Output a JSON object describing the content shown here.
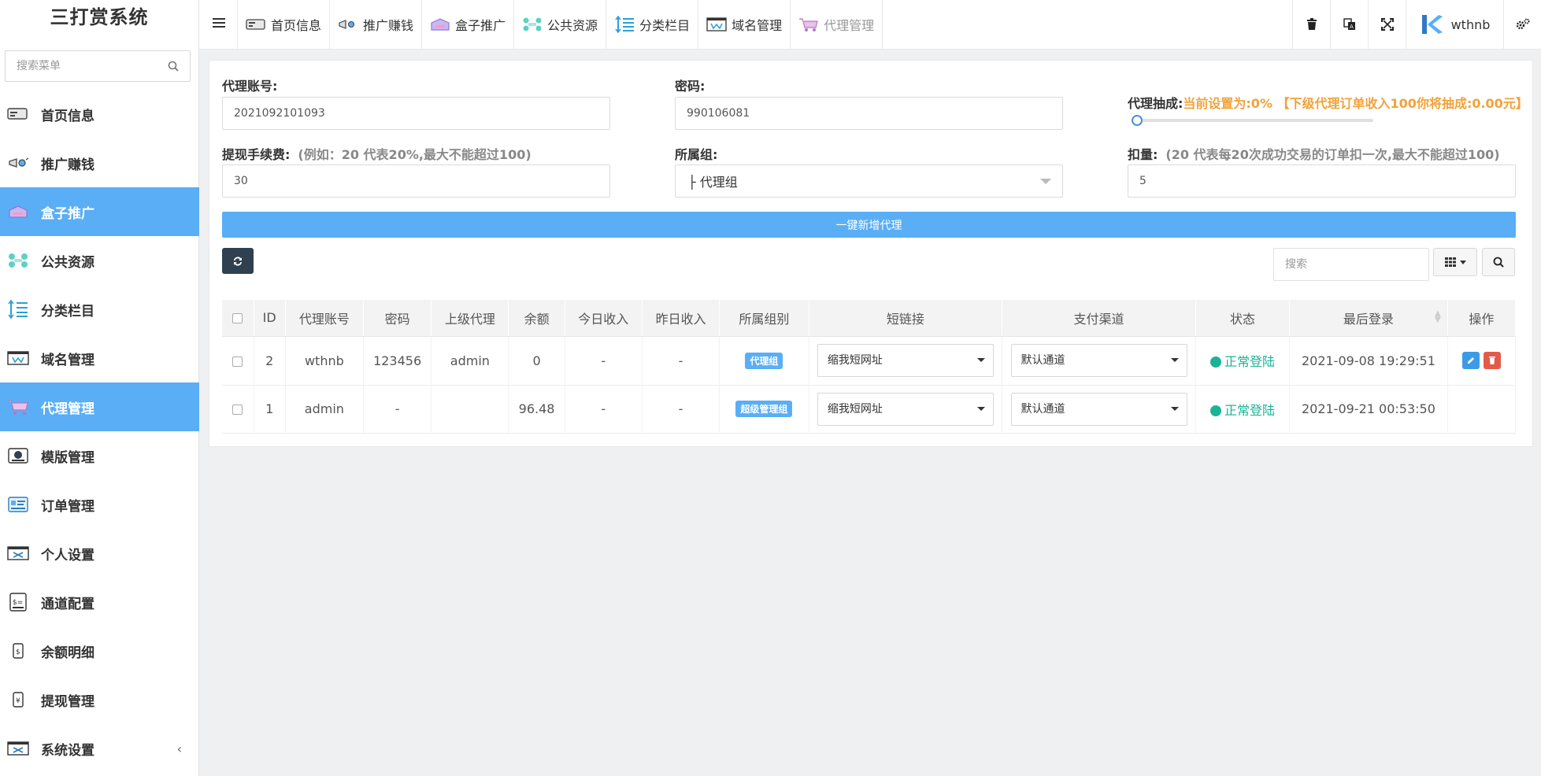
{
  "app": {
    "title": "三打赏系统"
  },
  "sidebar": {
    "search_placeholder": "搜索菜单",
    "items": [
      {
        "label": "首页信息",
        "icon": "home-card-icon",
        "active": false
      },
      {
        "label": "推广赚钱",
        "icon": "megaphone-icon",
        "active": false
      },
      {
        "label": "盒子推广",
        "icon": "box-icon",
        "active": true
      },
      {
        "label": "公共资源",
        "icon": "share-icon",
        "active": false
      },
      {
        "label": "分类栏目",
        "icon": "list-icon",
        "active": false
      },
      {
        "label": "域名管理",
        "icon": "domain-icon",
        "active": false
      },
      {
        "label": "代理管理",
        "icon": "cart-icon",
        "active": true
      },
      {
        "label": "模版管理",
        "icon": "template-icon",
        "active": false
      },
      {
        "label": "订单管理",
        "icon": "order-icon",
        "active": false
      },
      {
        "label": "个人设置",
        "icon": "settings-card-icon",
        "active": false
      },
      {
        "label": "通道配置",
        "icon": "channel-icon",
        "active": false
      },
      {
        "label": "余额明细",
        "icon": "balance-icon",
        "active": false
      },
      {
        "label": "提现管理",
        "icon": "withdraw-icon",
        "active": false
      },
      {
        "label": "系统设置",
        "icon": "system-icon",
        "active": false,
        "arrow": "‹"
      }
    ]
  },
  "topnav": {
    "tabs": [
      {
        "label": "首页信息",
        "icon": "home-card-icon"
      },
      {
        "label": "推广赚钱",
        "icon": "megaphone-icon"
      },
      {
        "label": "盒子推广",
        "icon": "box-icon"
      },
      {
        "label": "公共资源",
        "icon": "share-icon"
      },
      {
        "label": "分类栏目",
        "icon": "list-icon"
      },
      {
        "label": "域名管理",
        "icon": "domain-icon"
      },
      {
        "label": "代理管理",
        "icon": "cart-icon"
      }
    ],
    "user": "wthnb"
  },
  "form": {
    "account_label": "代理账号:",
    "account_value": "2021092101093",
    "password_label": "密码:",
    "password_value": "990106081",
    "commission_label": "代理抽成:",
    "commission_hint": "当前设置为:0% 【下级代理订单收入100你将抽成:0.00元】",
    "commission_percent": 0,
    "fee_label": "提现手续费:",
    "fee_hint": "(例如：20 代表20%,最大不能超过100)",
    "fee_value": "30",
    "group_label": "所属组:",
    "group_value": "├ 代理组",
    "deduct_label": "扣量:",
    "deduct_hint": "(20 代表每20次成功交易的订单扣一次,最大不能超过100)",
    "deduct_value": "5",
    "add_button": "一键新增代理"
  },
  "toolbar": {
    "search_placeholder": "搜索"
  },
  "table": {
    "headers": [
      "ID",
      "代理账号",
      "密码",
      "上级代理",
      "余额",
      "今日收入",
      "昨日收入",
      "所属组别",
      "短链接",
      "支付渠道",
      "状态",
      "最后登录",
      "操作"
    ],
    "rows": [
      {
        "id": "2",
        "account": "wthnb",
        "password": "123456",
        "parent": "admin",
        "balance": "0",
        "today": "-",
        "yesterday": "-",
        "group": "代理组",
        "short_link": "缩我短网址",
        "channel": "默认通道",
        "status": "正常登陆",
        "last_login": "2021-09-08 19:29:51"
      },
      {
        "id": "1",
        "account": "admin",
        "password": "-",
        "parent": "",
        "balance": "96.48",
        "today": "-",
        "yesterday": "-",
        "group": "超级管理组",
        "short_link": "缩我短网址",
        "channel": "默认通道",
        "status": "正常登陆",
        "last_login": "2021-09-21 00:53:50"
      }
    ]
  },
  "colors": {
    "accent": "#5aaef5",
    "success": "#1bb394",
    "danger": "#e35a4a",
    "dark": "#2f4050",
    "orange": "#f2a23a"
  }
}
